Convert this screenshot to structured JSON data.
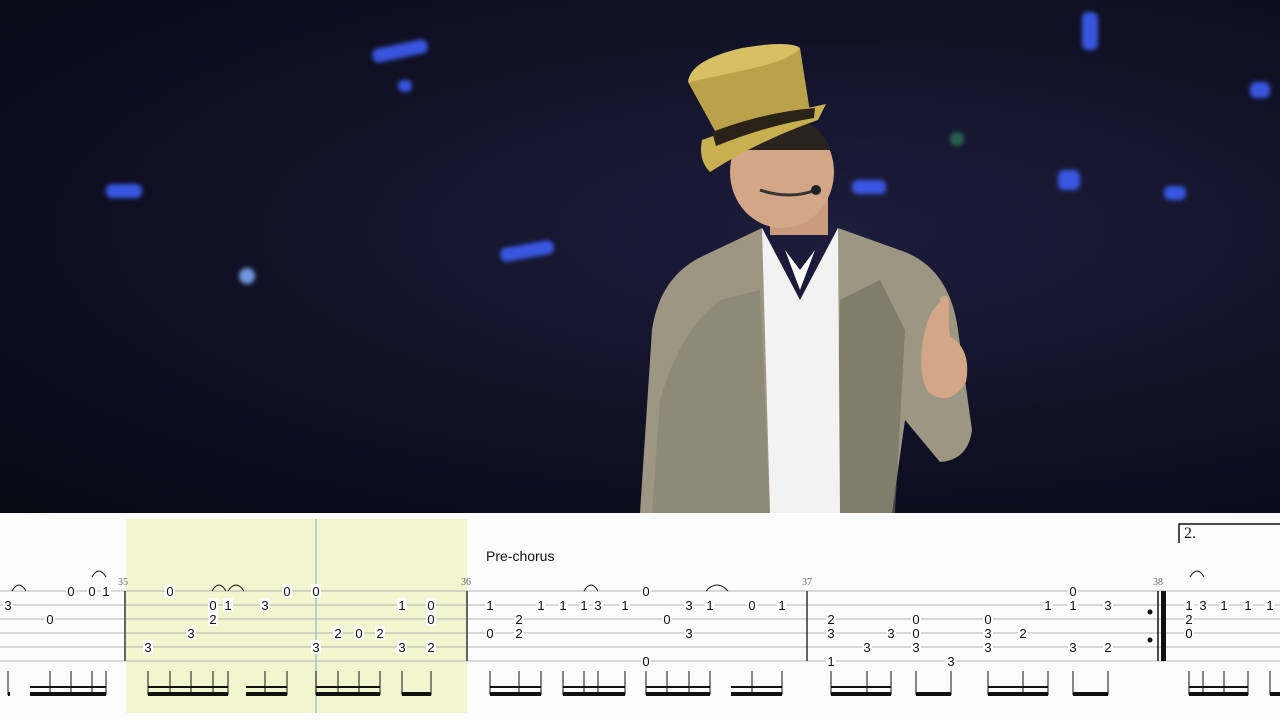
{
  "video": {
    "scene": "concert-performer",
    "colors": {
      "background": "#10102a",
      "stage_light": "#3f62ff",
      "hat": "#b9a24a",
      "suit": "#9a9480"
    }
  },
  "tab": {
    "section_label": "Pre-chorus",
    "ending_label": "2.",
    "highlight_color": "#f1f6cf",
    "measure_numbers": [
      "35",
      "36",
      "37",
      "38"
    ],
    "notes": [
      {
        "s": 2,
        "t": "3"
      },
      {
        "s": 1,
        "t": "0"
      },
      {
        "s": 3,
        "t": "0"
      },
      {
        "s": 1,
        "t": "0"
      },
      {
        "s": 1,
        "t": "1"
      },
      {
        "s": 5,
        "t": "3"
      },
      {
        "s": 1,
        "t": "0"
      },
      {
        "s": 4,
        "t": "3"
      },
      {
        "s": 2,
        "t": "0"
      },
      {
        "s": 3,
        "t": "2"
      },
      {
        "s": 2,
        "t": "1"
      },
      {
        "s": 2,
        "t": "3"
      },
      {
        "s": 1,
        "t": "0"
      },
      {
        "s": 1,
        "t": "0"
      },
      {
        "s": 5,
        "t": "3"
      },
      {
        "s": 4,
        "t": "2"
      },
      {
        "s": 4,
        "t": "0"
      },
      {
        "s": 4,
        "t": "2"
      },
      {
        "s": 2,
        "t": "1"
      },
      {
        "s": 2,
        "t": "0"
      },
      {
        "s": 3,
        "t": "0"
      },
      {
        "s": 5,
        "t": "3"
      },
      {
        "s": 5,
        "t": "2"
      },
      {
        "s": 2,
        "t": "1"
      },
      {
        "s": 3,
        "t": "2"
      },
      {
        "s": 4,
        "t": "0"
      },
      {
        "s": 4,
        "t": "2"
      },
      {
        "s": 2,
        "t": "1"
      },
      {
        "s": 2,
        "t": "1"
      },
      {
        "s": 2,
        "t": "1"
      },
      {
        "s": 2,
        "t": "3"
      },
      {
        "s": 2,
        "t": "1"
      },
      {
        "s": 1,
        "t": "0"
      },
      {
        "s": 3,
        "t": "0"
      },
      {
        "s": 6,
        "t": "0"
      },
      {
        "s": 2,
        "t": "3"
      },
      {
        "s": 4,
        "t": "3"
      },
      {
        "s": 2,
        "t": "1"
      },
      {
        "s": 2,
        "t": "0"
      },
      {
        "s": 2,
        "t": "1"
      },
      {
        "s": 3,
        "t": "2"
      },
      {
        "s": 4,
        "t": "3"
      },
      {
        "s": 6,
        "t": "1"
      },
      {
        "s": 5,
        "t": "3"
      },
      {
        "s": 4,
        "t": "3"
      },
      {
        "s": 3,
        "t": "0"
      },
      {
        "s": 4,
        "t": "0"
      },
      {
        "s": 5,
        "t": "3"
      },
      {
        "s": 6,
        "t": "3"
      },
      {
        "s": 4,
        "t": "3"
      },
      {
        "s": 3,
        "t": "0"
      },
      {
        "s": 5,
        "t": "3"
      },
      {
        "s": 4,
        "t": "2"
      },
      {
        "s": 2,
        "t": "1"
      },
      {
        "s": 1,
        "t": "0"
      },
      {
        "s": 2,
        "t": "1"
      },
      {
        "s": 5,
        "t": "3"
      },
      {
        "s": 2,
        "t": "3"
      },
      {
        "s": 5,
        "t": "2"
      },
      {
        "s": 2,
        "t": "1"
      },
      {
        "s": 3,
        "t": "2"
      },
      {
        "s": 4,
        "t": "0"
      },
      {
        "s": 2,
        "t": "3"
      },
      {
        "s": 2,
        "t": "1"
      },
      {
        "s": 2,
        "t": "1"
      },
      {
        "s": 2,
        "t": "1"
      }
    ]
  }
}
